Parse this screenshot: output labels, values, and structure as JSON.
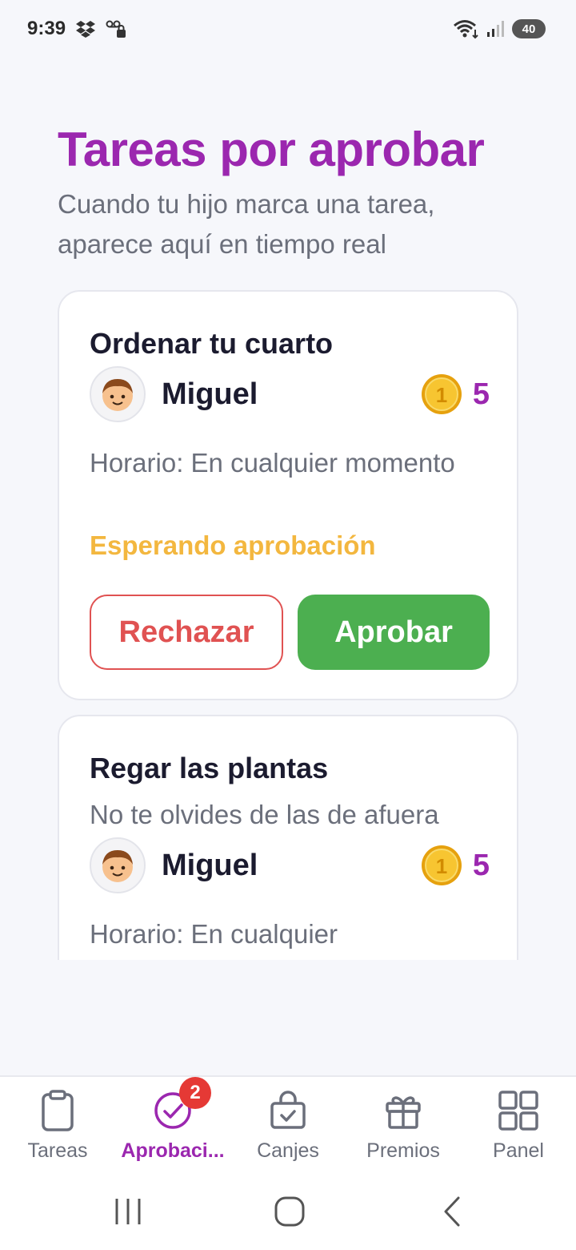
{
  "status_bar": {
    "time": "9:39",
    "battery": "40"
  },
  "header": {
    "title": "Tareas por aprobar",
    "subtitle": "Cuando tu hijo marca una tarea, aparece aquí en tiempo real"
  },
  "tasks": [
    {
      "title": "Ordenar tu cuarto",
      "kid": "Miguel",
      "points": "5",
      "schedule": "Horario: En cualquier momento",
      "status": "Esperando aprobación",
      "reject_label": "Rechazar",
      "approve_label": "Aprobar"
    },
    {
      "title": "Regar las plantas",
      "note": "No te olvides de las de afuera",
      "kid": "Miguel",
      "points": "5",
      "schedule": "Horario: En cualquier"
    }
  ],
  "bottom_nav": {
    "items": [
      {
        "label": "Tareas"
      },
      {
        "label": "Aprobaci...",
        "badge": "2"
      },
      {
        "label": "Canjes"
      },
      {
        "label": "Premios"
      },
      {
        "label": "Panel"
      }
    ],
    "active_index": 1
  },
  "colors": {
    "accent": "#9b27af",
    "approve": "#4caf50",
    "reject": "#e05252",
    "pending": "#f3b73f"
  }
}
